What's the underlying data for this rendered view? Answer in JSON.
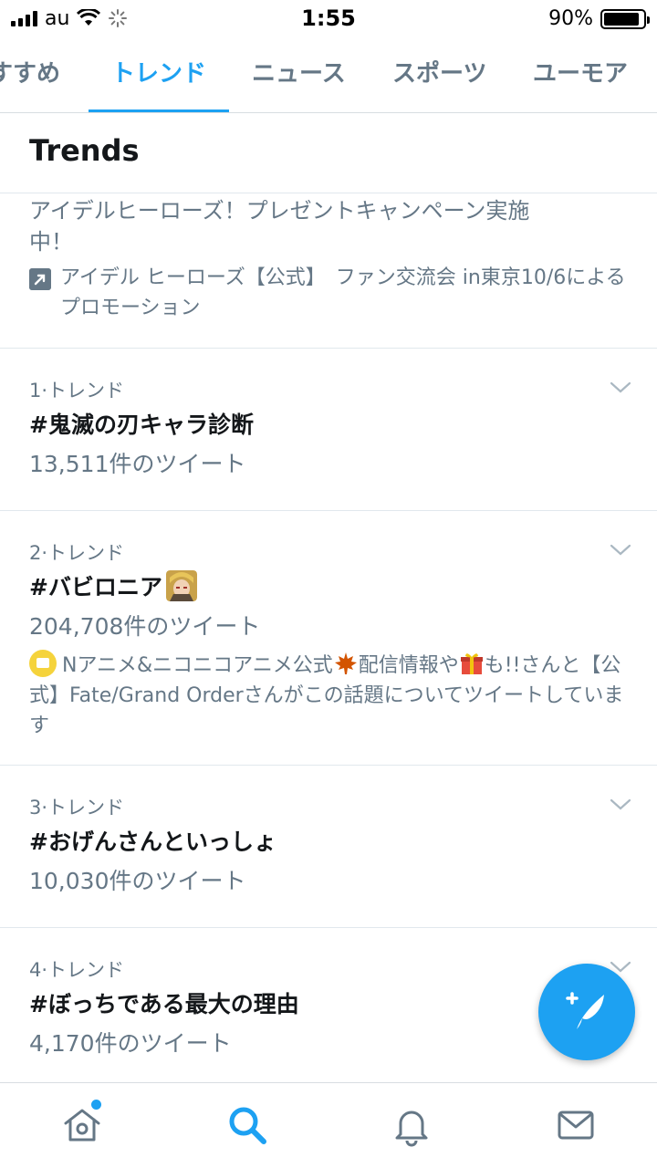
{
  "status_bar": {
    "carrier": "au",
    "time": "1:55",
    "battery_percent": "90%",
    "battery_level": 0.9
  },
  "tabs": [
    {
      "label": "すすめ",
      "active": false
    },
    {
      "label": "トレンド",
      "active": true
    },
    {
      "label": "ニュース",
      "active": false
    },
    {
      "label": "スポーツ",
      "active": false
    },
    {
      "label": "ユーモア",
      "active": false
    }
  ],
  "trends_header": {
    "title": "Trends"
  },
  "promoted": {
    "title": "アイデルヒーローズ！プレゼントキャンペーン実施中！",
    "promoted_by": "アイデル ヒーローズ【公式】　ファン交流会 in東京10/6によるプロモーション",
    "icon": "promoted-arrow-icon"
  },
  "trends": [
    {
      "meta": "1·トレンド",
      "name": "#鬼滅の刃キャラ診断",
      "count": "13,511件のツイート"
    },
    {
      "meta": "2·トレンド",
      "name": "#バビロニア",
      "count": "204,708件のツイート",
      "context_part1": "Nアニメ&ニコニコアニメ公式",
      "context_part2": "配信情報や",
      "context_part3": "も!!さんと【公式】Fate/Grand Orderさんがこの話題についてツイートしています"
    },
    {
      "meta": "3·トレンド",
      "name": "#おげんさんといっしょ",
      "count": "10,030件のツイート"
    },
    {
      "meta": "4·トレンド",
      "name": "#ぼっちである最大の理由",
      "count": "4,170件のツイート"
    }
  ],
  "fab": {
    "icon": "compose-tweet-icon"
  },
  "bottom_nav": [
    {
      "icon": "home-icon",
      "has_notification_dot": true
    },
    {
      "icon": "search-icon",
      "active": true
    },
    {
      "icon": "notifications-bell-icon"
    },
    {
      "icon": "messages-mail-icon"
    }
  ],
  "colors": {
    "accent": "#1da1f2",
    "secondary_text": "#657786",
    "primary_text": "#14171a",
    "divider": "#e1e8ed"
  }
}
